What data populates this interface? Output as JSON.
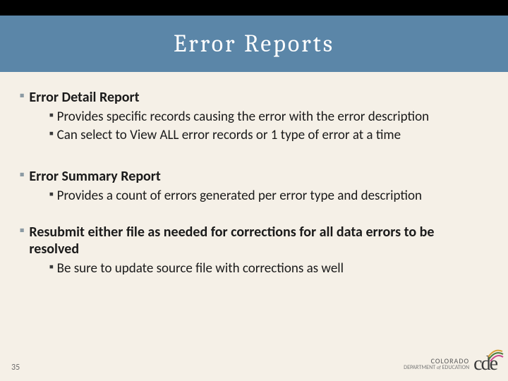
{
  "title": "Error Reports",
  "sections": [
    {
      "heading": "Error Detail Report",
      "bold": true,
      "items": [
        "Provides specific records causing the error with the error description",
        "Can select to View ALL error records or 1 type of error at a time"
      ]
    },
    {
      "heading": "Error Summary Report",
      "bold": true,
      "items": [
        "Provides a count of errors generated per error type and description"
      ]
    },
    {
      "heading": "Resubmit either file as needed for corrections for all data errors to be resolved",
      "bold": true,
      "items": [
        "Be sure to update source file with corrections as well"
      ]
    }
  ],
  "page_number": "35",
  "logo": {
    "state": "COLORADO",
    "dept_prefix": "DEPARTMENT",
    "dept_of": "of",
    "dept_suffix": "EDUCATION",
    "abbr_c": "c",
    "abbr_d": "d",
    "abbr_e": "e"
  }
}
